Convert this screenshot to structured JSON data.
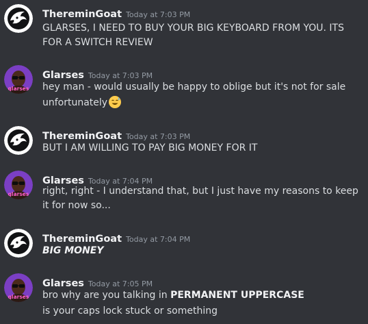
{
  "messages": [
    {
      "author": "ThereminGoat",
      "timestamp": "Today at 7:03 PM",
      "avatar": "goat-avatar",
      "lines": [
        "GLARSES, I NEED TO BUY YOUR BIG KEYBOARD FROM YOU. ITS",
        "FOR A SWITCH REVIEW"
      ]
    },
    {
      "author": "Glarses",
      "timestamp": "Today at 7:03 PM",
      "avatar": "glarses-avatar",
      "avatar_label": "glarses",
      "lines": [
        "hey man - would usually be happy to oblige but it's not for sale",
        "unfortunately"
      ],
      "emoji": "sweat-smile-emoji"
    },
    {
      "author": "ThereminGoat",
      "timestamp": "Today at 7:03 PM",
      "avatar": "goat-avatar",
      "lines": [
        "BUT I AM WILLING TO PAY BIG MONEY FOR IT"
      ]
    },
    {
      "author": "Glarses",
      "timestamp": "Today at 7:04 PM",
      "avatar": "glarses-avatar",
      "avatar_label": "glarses",
      "lines": [
        "right, right - I understand that, but I just have my reasons to keep",
        "it for now so..."
      ]
    },
    {
      "author": "ThereminGoat",
      "timestamp": "Today at 7:04 PM",
      "avatar": "goat-avatar",
      "lines": [
        "BIG MONEY"
      ]
    },
    {
      "author": "Glarses",
      "timestamp": "Today at 7:05 PM",
      "avatar": "glarses-avatar",
      "avatar_label": "glarses",
      "line1_prefix": "bro why are you talking in ",
      "line1_bold": "PERMANENT UPPERCASE",
      "lines": [
        "is your caps lock stuck or something"
      ]
    }
  ],
  "colors": {
    "background": "#313338",
    "author": "#f2f3f5",
    "timestamp": "#949ba4",
    "text": "#dbdee1",
    "glarses_avatar_bg": "#7b3fc4"
  }
}
